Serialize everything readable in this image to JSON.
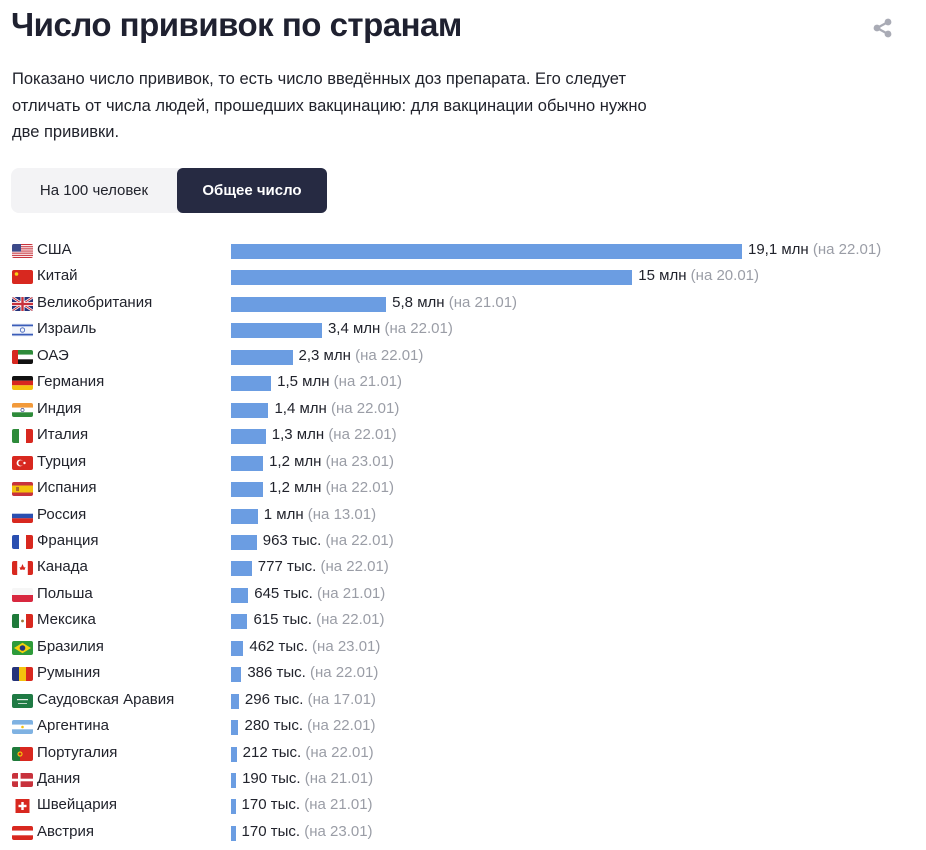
{
  "header": {
    "title": "Число прививок по странам",
    "description": "Показано число прививок, то есть число введённых доз препарата. Его следует отличать от числа людей, прошедших вакцинацию: для вакцинации обычно нужно две прививки.",
    "share_icon": "share-icon"
  },
  "toggle": {
    "options": [
      {
        "label": "На 100 человек",
        "active": false
      },
      {
        "label": "Общее число",
        "active": true
      }
    ]
  },
  "colors": {
    "bar": "#6b9de2",
    "active_tab": "#262a42",
    "date_text": "#9a9da6"
  },
  "chart_data": {
    "type": "bar",
    "orientation": "horizontal",
    "title": "Число прививок по странам",
    "xlabel": "",
    "ylabel": "",
    "unit": "doses",
    "categories": [
      "США",
      "Китай",
      "Великобритания",
      "Израиль",
      "ОАЭ",
      "Германия",
      "Индия",
      "Италия",
      "Турция",
      "Испания",
      "Россия",
      "Франция",
      "Канада",
      "Польша",
      "Мексика",
      "Бразилия",
      "Румыния",
      "Саудовская Аравия",
      "Аргентина",
      "Португалия",
      "Дания",
      "Швейцария",
      "Австрия"
    ],
    "values": [
      19100000,
      15000000,
      5800000,
      3400000,
      2300000,
      1500000,
      1400000,
      1300000,
      1200000,
      1200000,
      1000000,
      963000,
      777000,
      645000,
      615000,
      462000,
      386000,
      296000,
      280000,
      212000,
      190000,
      170000,
      170000
    ],
    "labels": [
      "19,1 млн",
      "15 млн",
      "5,8 млн",
      "3,4 млн",
      "2,3 млн",
      "1,5 млн",
      "1,4 млн",
      "1,3 млн",
      "1,2 млн",
      "1,2 млн",
      "1 млн",
      "963 тыс.",
      "777 тыс.",
      "645 тыс.",
      "615 тыс.",
      "462 тыс.",
      "386 тыс.",
      "296 тыс.",
      "280 тыс.",
      "212 тыс.",
      "190 тыс.",
      "170 тыс.",
      "170 тыс."
    ],
    "dates": [
      "(на 22.01)",
      "(на 20.01)",
      "(на 21.01)",
      "(на 22.01)",
      "(на 22.01)",
      "(на 21.01)",
      "(на 22.01)",
      "(на 22.01)",
      "(на 23.01)",
      "(на 22.01)",
      "(на 13.01)",
      "(на 22.01)",
      "(на 22.01)",
      "(на 21.01)",
      "(на 22.01)",
      "(на 23.01)",
      "(на 22.01)",
      "(на 17.01)",
      "(на 22.01)",
      "(на 22.01)",
      "(на 21.01)",
      "(на 21.01)",
      "(на 23.01)"
    ],
    "flags": [
      "us",
      "cn",
      "gb",
      "il",
      "ae",
      "de",
      "in",
      "it",
      "tr",
      "es",
      "ru",
      "fr",
      "ca",
      "pl",
      "mx",
      "br",
      "ro",
      "sa",
      "ar",
      "pt",
      "dk",
      "ch",
      "at"
    ],
    "xlim": [
      0,
      19100000
    ],
    "grid": false,
    "legend": "none"
  }
}
